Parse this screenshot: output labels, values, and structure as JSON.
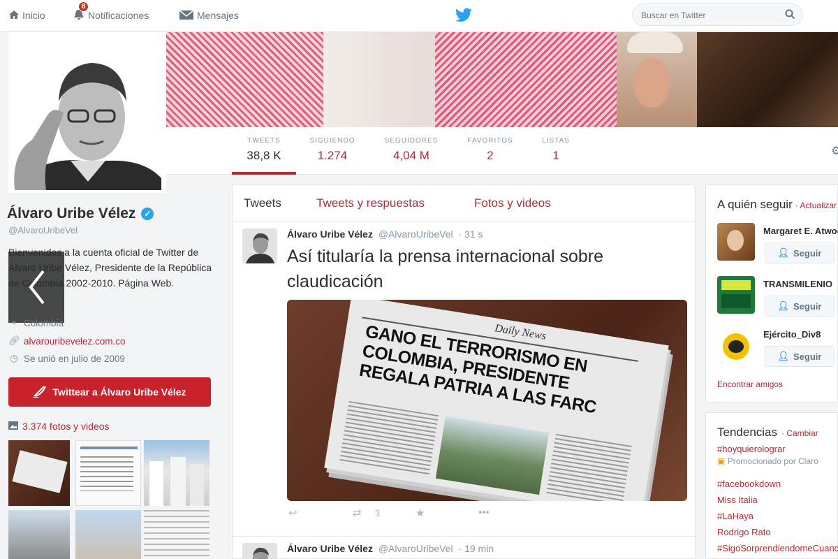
{
  "nav": {
    "home": "Inicio",
    "notifications": "Notificaciones",
    "notifications_count": "8",
    "messages": "Mensajes",
    "search_placeholder": "Buscar en Twitter"
  },
  "stats": [
    {
      "label": "TWEETS",
      "value": "38,8 K"
    },
    {
      "label": "SIGUIENDO",
      "value": "1.274"
    },
    {
      "label": "SEGUIDORES",
      "value": "4,04 M"
    },
    {
      "label": "FAVORITOS",
      "value": "2"
    },
    {
      "label": "LISTAS",
      "value": "1"
    }
  ],
  "profile": {
    "name": "Álvaro Uribe Vélez",
    "handle": "@AlvaroUribeVel",
    "bio": "Bienvenidos a la cuenta oficial de Twitter de Álvaro Uribe Vélez, Presidente de la República de Colombia 2002-2010. Página Web.",
    "location": "Colombia",
    "website": "alvarouribevelez.com.co",
    "joined": "Se unió en julio de 2009",
    "tweet_to_button": "Twittear a Álvaro Uribe Vélez",
    "photos_link": "3.374 fotos y videos"
  },
  "timeline": {
    "tabs": [
      "Tweets",
      "Tweets y respuestas",
      "Fotos y videos"
    ],
    "tweet1": {
      "name": "Álvaro Uribe Vélez",
      "handle": "@AlvaroUribeVel",
      "time": "· 31 s",
      "text": "Así titularía la prensa internacional sobre claudicación",
      "retweets": "3",
      "newspaper_masthead": "Daily News",
      "newspaper_headline": "GANO EL TERRORISMO EN COLOMBIA, PRESIDENTE REGALA PATRIA A LAS FARC"
    },
    "tweet2": {
      "name": "Álvaro Uribe Vélez",
      "handle": "@AlvaroUribeVel",
      "time": "· 19 min"
    }
  },
  "who_to_follow": {
    "title": "A quién seguir",
    "refresh": "· Actualizar",
    "follow_label": "Seguir",
    "suggestions": [
      {
        "name": "Margaret E. Atwood"
      },
      {
        "name": "TRANSMILENIO"
      },
      {
        "name": "Ejército_Div8"
      }
    ],
    "find_friends": "Encontrar amigos"
  },
  "trends": {
    "title": "Tendencias",
    "change": "· Cambiar",
    "promoted": "Promocionado por Claro",
    "items": [
      "#hoyquierolograr",
      "#facebookdown",
      "Miss Italia",
      "#LaHaya",
      "Rodrigo Rato",
      "#SigoSorprendiendomeCuando"
    ]
  },
  "colors": {
    "accent": "#b52a36",
    "tweet_button": "#c8232c",
    "twitter_blue": "#2aa3ef"
  }
}
